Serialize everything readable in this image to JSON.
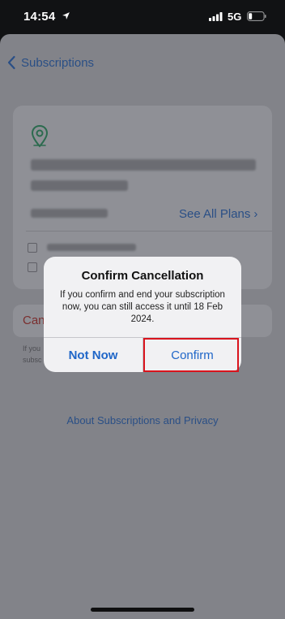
{
  "status_bar": {
    "time": "14:54",
    "network": "5G",
    "icons": [
      "location-arrow-icon",
      "signal-bars-icon",
      "battery-icon"
    ]
  },
  "nav": {
    "back_label": "Subscriptions",
    "back_icon": "chevron-left-icon"
  },
  "subscription_card": {
    "app_icon": "location-pin-icon",
    "see_all_label": "See All Plans",
    "see_all_chevron": "›"
  },
  "cancel": {
    "label_visible": "Can",
    "note_visible_lines": [
      "If you",
      "subsc"
    ]
  },
  "about_link": "About Subscriptions and Privacy",
  "alert": {
    "title": "Confirm Cancellation",
    "message": "If you confirm and end your subscription now, you can still access it until 18 Feb 2024.",
    "not_now_label": "Not Now",
    "confirm_label": "Confirm"
  },
  "colors": {
    "accent_blue": "#1f66c8",
    "highlight_red": "#d9141d",
    "dim_link": "#2a4f86"
  }
}
